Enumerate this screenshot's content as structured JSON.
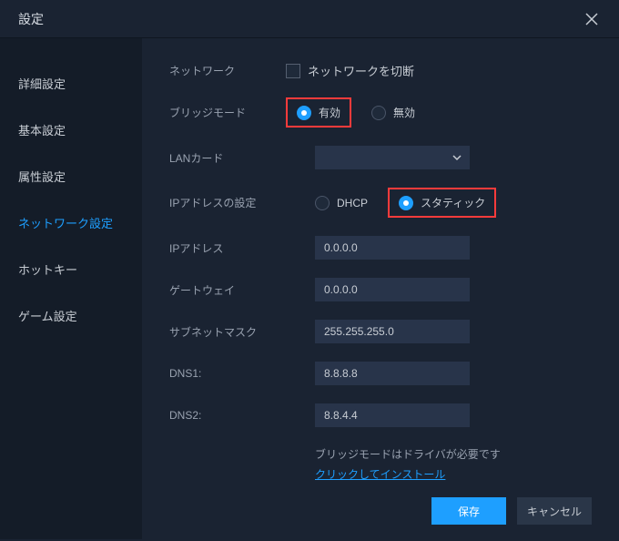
{
  "window": {
    "title": "設定"
  },
  "sidebar": {
    "items": [
      {
        "label": "詳細設定"
      },
      {
        "label": "基本設定"
      },
      {
        "label": "属性設定"
      },
      {
        "label": "ネットワーク設定"
      },
      {
        "label": "ホットキー"
      },
      {
        "label": "ゲーム設定"
      }
    ],
    "active_index": 3
  },
  "form": {
    "network": {
      "label": "ネットワーク",
      "checkbox_label": "ネットワークを切断",
      "checked": false
    },
    "bridge_mode": {
      "label": "ブリッジモード",
      "options": [
        {
          "label": "有効",
          "checked": true
        },
        {
          "label": "無効",
          "checked": false
        }
      ]
    },
    "lan_card": {
      "label": "LANカード",
      "value": ""
    },
    "ip_setting": {
      "label": "IPアドレスの設定",
      "options": [
        {
          "label": "DHCP",
          "checked": false
        },
        {
          "label": "スタティック",
          "checked": true
        }
      ]
    },
    "ip_address": {
      "label": "IPアドレス",
      "value": "0.0.0.0"
    },
    "gateway": {
      "label": "ゲートウェイ",
      "value": "0.0.0.0"
    },
    "subnet": {
      "label": "サブネットマスク",
      "value": "255.255.255.0"
    },
    "dns1": {
      "label": "DNS1:",
      "value": "8.8.8.8"
    },
    "dns2": {
      "label": "DNS2:",
      "value": "8.8.4.4"
    },
    "note": {
      "text": "ブリッジモードはドライバが必要です",
      "link": "クリックしてインストール"
    }
  },
  "footer": {
    "save": "保存",
    "cancel": "キャンセル"
  }
}
